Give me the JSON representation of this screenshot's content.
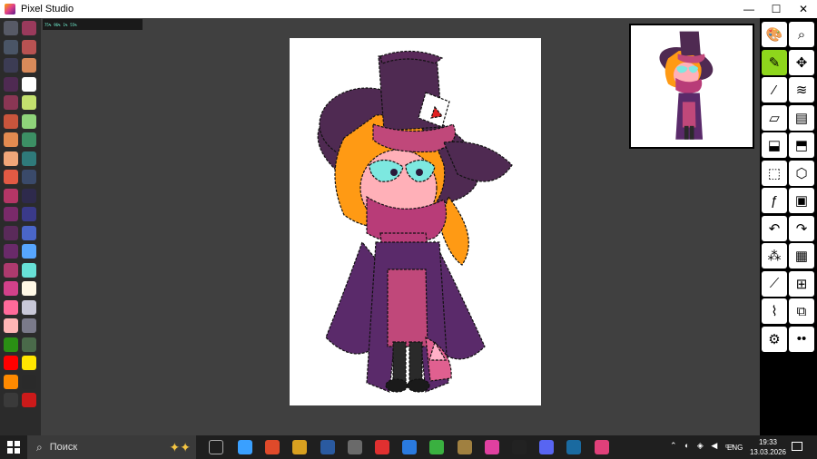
{
  "window": {
    "title": "Pixel Studio",
    "minimize": "—",
    "maximize": "☐",
    "close": "✕"
  },
  "palette": {
    "colors": [
      "#575a66",
      "#9a3a5c",
      "#4a5566",
      "#b85252",
      "#3c3c54",
      "#d98a5a",
      "#4f2a52",
      "#ffffff",
      "#8a3654",
      "#c3e06e",
      "#c8553c",
      "#8fd37a",
      "#e38b50",
      "#3c8f64",
      "#f1a779",
      "#2f7a7a",
      "#e25a44",
      "#3a4a6a",
      "#b53666",
      "#2e2a4c",
      "#7a2a6a",
      "#3a3a8a",
      "#5a2a5a",
      "#4a66c8",
      "#6a2a6a",
      "#57a6ff",
      "#ad3a6e",
      "#67e0d6",
      "#d2418a",
      "#fff8e6",
      "#ff6a9a",
      "#c8c8d8",
      "#ffb6b6",
      "#7a7a8a",
      "#2a8f14",
      "#4a6a4a",
      "#ff0000",
      "#ffe600",
      "#ff8a00",
      "#2a2a2a",
      "#3a3a3a",
      "#cc1a1a"
    ]
  },
  "perf": [
    "75%",
    "96%",
    "1%",
    "55%"
  ],
  "toolbar": {
    "tools": [
      "palette-icon",
      "zoom-icon",
      "pencil-icon",
      "move-icon",
      "eyedropper-icon",
      "layers-icon",
      "eraser-icon",
      "frames-icon",
      "fill-icon",
      "shading-icon",
      "selection-icon",
      "shape-icon",
      "effects-icon",
      "image-icon",
      "undo-icon",
      "redo-icon",
      "magic-wand-icon",
      "dither-icon",
      "brush-icon",
      "grid-icon",
      "paint-brush-icon",
      "windows-icon",
      "settings-icon",
      "more-icon"
    ],
    "active": 2
  },
  "taskbar": {
    "search_label": "Поиск",
    "language": "ENG",
    "time": "19:33",
    "date": "13.03.2026",
    "apps": [
      "#3aa0ff",
      "#e04a2a",
      "#d8a020",
      "#2a5aa0",
      "#6a6a6a",
      "#e03030",
      "#2a7adf",
      "#3ab040",
      "#a08040",
      "#e040a0",
      "#222222",
      "#5865f2",
      "#1a6aa0",
      "#e0407a"
    ]
  },
  "colors": {
    "accent": "#8ed61c",
    "background": "#404040",
    "toolbar": "#000000"
  }
}
